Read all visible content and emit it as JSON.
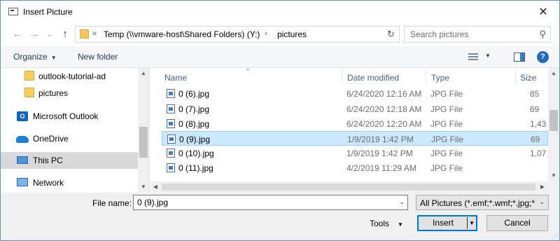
{
  "window": {
    "title": "Insert Picture",
    "close_glyph": "✕"
  },
  "nav": {
    "back_glyph": "←",
    "forward_glyph": "→",
    "recent_glyph": "⌄",
    "up_glyph": "↑"
  },
  "address": {
    "overflow": "«",
    "segment_1": "Temp (\\\\vmware-host\\Shared Folders) (Y:)",
    "separator": "›",
    "segment_2": "pictures",
    "chevron": "⌄",
    "refresh_glyph": "↻"
  },
  "search": {
    "placeholder": "Search pictures",
    "icon_glyph": "⚲"
  },
  "toolbar": {
    "organize_label": "Organize",
    "new_folder_label": "New folder",
    "caret": "▼",
    "help_glyph": "?"
  },
  "sidebar": {
    "items": [
      {
        "label": "outlook-tutorial-ad",
        "icon": "folder-icon"
      },
      {
        "label": "pictures",
        "icon": "folder-icon"
      },
      {
        "label": "Microsoft Outlook",
        "icon": "outlook-icon"
      },
      {
        "label": "OneDrive",
        "icon": "onedrive-icon"
      },
      {
        "label": "This PC",
        "icon": "this-pc-icon",
        "selected": true
      },
      {
        "label": "Network",
        "icon": "network-icon"
      }
    ],
    "outlook_icon_letter": "O"
  },
  "columns": {
    "name": "Name",
    "date": "Date modified",
    "type": "Type",
    "size": "Size",
    "sort_glyph": "^"
  },
  "files": [
    {
      "name": "0 (6).jpg",
      "date": "6/24/2020 12:16 AM",
      "type": "JPG File",
      "size": "85"
    },
    {
      "name": "0 (7).jpg",
      "date": "6/24/2020 12:18 AM",
      "type": "JPG File",
      "size": "69"
    },
    {
      "name": "0 (8).jpg",
      "date": "6/24/2020 12:20 AM",
      "type": "JPG File",
      "size": "1,43"
    },
    {
      "name": "0 (9).jpg",
      "date": "1/9/2019 1:42 PM",
      "type": "JPG File",
      "size": "69",
      "selected": true
    },
    {
      "name": "0 (10).jpg",
      "date": "1/9/2019 1:42 PM",
      "type": "JPG File",
      "size": "1,07"
    },
    {
      "name": "0 (11).jpg",
      "date": "4/2/2019 11:29 AM",
      "type": "JPG File",
      "size": ""
    }
  ],
  "scroll": {
    "up": "▲",
    "down": "▼",
    "left": "◀",
    "right": "▶"
  },
  "bottom": {
    "file_name_label": "File name:",
    "file_name_value": "0 (9).jpg",
    "combo_caret": "⌄",
    "filter_value": "All Pictures (*.emf;*.wmf;*.jpg;*",
    "tools_label": "Tools",
    "tools_caret": "▼",
    "insert_label": "Insert",
    "insert_caret": "▼",
    "cancel_label": "Cancel",
    "grip_glyph": "⋰"
  },
  "colors": {
    "accent": "#0078d7",
    "selection": "#cce8ff",
    "folder": "#f6cd5b"
  }
}
